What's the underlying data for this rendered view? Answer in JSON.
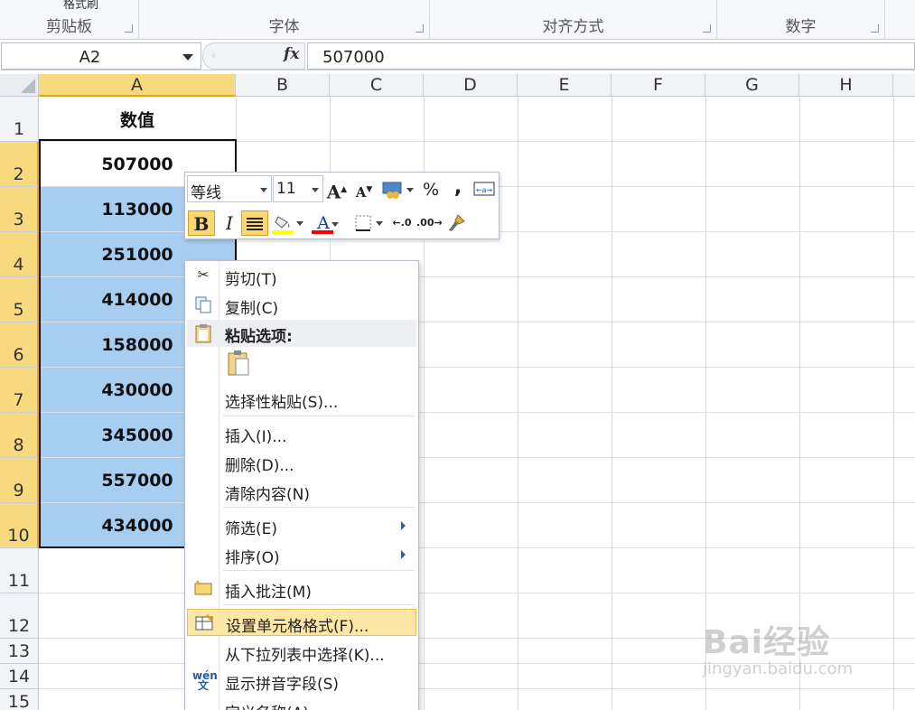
{
  "ribbon": {
    "groups": [
      "剪贴板",
      "字体",
      "对齐方式",
      "数字"
    ],
    "format_painter": "格式刷"
  },
  "formula_bar": {
    "name_box": "A2",
    "fx": "fx",
    "value": "507000"
  },
  "columns": [
    "A",
    "B",
    "C",
    "D",
    "E",
    "F",
    "G",
    "H"
  ],
  "rows": [
    "1",
    "2",
    "3",
    "4",
    "5",
    "6",
    "7",
    "8",
    "9",
    "10",
    "11",
    "12",
    "13",
    "14",
    "15"
  ],
  "column_a": {
    "header": "数值",
    "values": [
      "507000",
      "113000",
      "251000",
      "414000",
      "158000",
      "430000",
      "345000",
      "557000",
      "434000"
    ]
  },
  "mini_toolbar": {
    "font": "等线",
    "size": "11",
    "grow_font": "A",
    "shrink_font": "A",
    "percent": "%",
    "comma": ",",
    "bold": "B",
    "italic": "I",
    "font_color_label": "A",
    "colors": {
      "highlight": "#ffff00",
      "font": "#ff0000"
    }
  },
  "context_menu": {
    "cut": "剪切(T)",
    "copy": "复制(C)",
    "paste_options": "粘贴选项:",
    "paste_special": "选择性粘贴(S)...",
    "insert": "插入(I)...",
    "delete": "删除(D)...",
    "clear": "清除内容(N)",
    "filter": "筛选(E)",
    "sort": "排序(O)",
    "insert_comment": "插入批注(M)",
    "format_cells": "设置单元格格式(F)...",
    "pick_from_list": "从下拉列表中选择(K)...",
    "phonetic": "显示拼音字段(S)",
    "define_name": "定义名称(A)..."
  },
  "watermark": {
    "brand": "Bai经验",
    "url": "jingyan.baidu.com"
  }
}
